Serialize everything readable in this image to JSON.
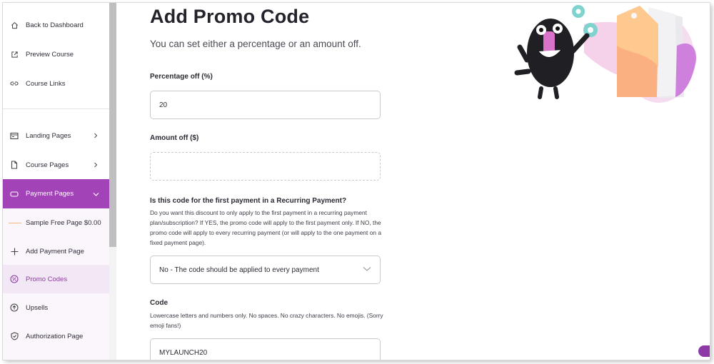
{
  "sidebar": {
    "items": [
      {
        "label": "Back to Dashboard",
        "icon": "home-icon"
      },
      {
        "label": "Preview Course",
        "icon": "external-link-icon"
      },
      {
        "label": "Course Links",
        "icon": "link-icon"
      },
      {
        "label": "Landing Pages",
        "icon": "landing-page-icon"
      },
      {
        "label": "Course Pages",
        "icon": "file-icon"
      },
      {
        "label": "Payment Pages",
        "icon": "payment-page-icon"
      },
      {
        "label": "Sample Free Page $0.00",
        "icon": "dash-line-icon"
      },
      {
        "label": "Add Payment Page",
        "icon": "plus-icon"
      },
      {
        "label": "Promo Codes",
        "icon": "percent-badge-icon"
      },
      {
        "label": "Upsells",
        "icon": "arrow-up-circle-icon"
      },
      {
        "label": "Authorization Page",
        "icon": "shield-check-icon"
      }
    ]
  },
  "main": {
    "title": "Add Promo Code",
    "subtitle": "You can set either a percentage or an amount off.",
    "percentage": {
      "label": "Percentage off (%)",
      "value": "20"
    },
    "amount": {
      "label": "Amount off ($)",
      "value": ""
    },
    "recurring": {
      "label": "Is this code for the first payment in a Recurring Payment?",
      "help": "Do you want this discount to only apply to the first payment in a recurring payment plan/subscription? If YES, the promo code will apply to the first payment only. If NO, the promo code will apply to every recurring payment (or will apply to the one payment on a fixed payment page).",
      "selected": "No - The code should be applied to every payment"
    },
    "code": {
      "label": "Code",
      "help": "Lowercase letters and numbers only. No spaces. No crazy characters. No emojis. (Sorry emoji fans!)",
      "value": "MYLAUNCH20"
    }
  },
  "colors": {
    "accent": "#a243b8",
    "selected_bg": "#f2e7f4",
    "selected_text": "#8f3aa5"
  }
}
